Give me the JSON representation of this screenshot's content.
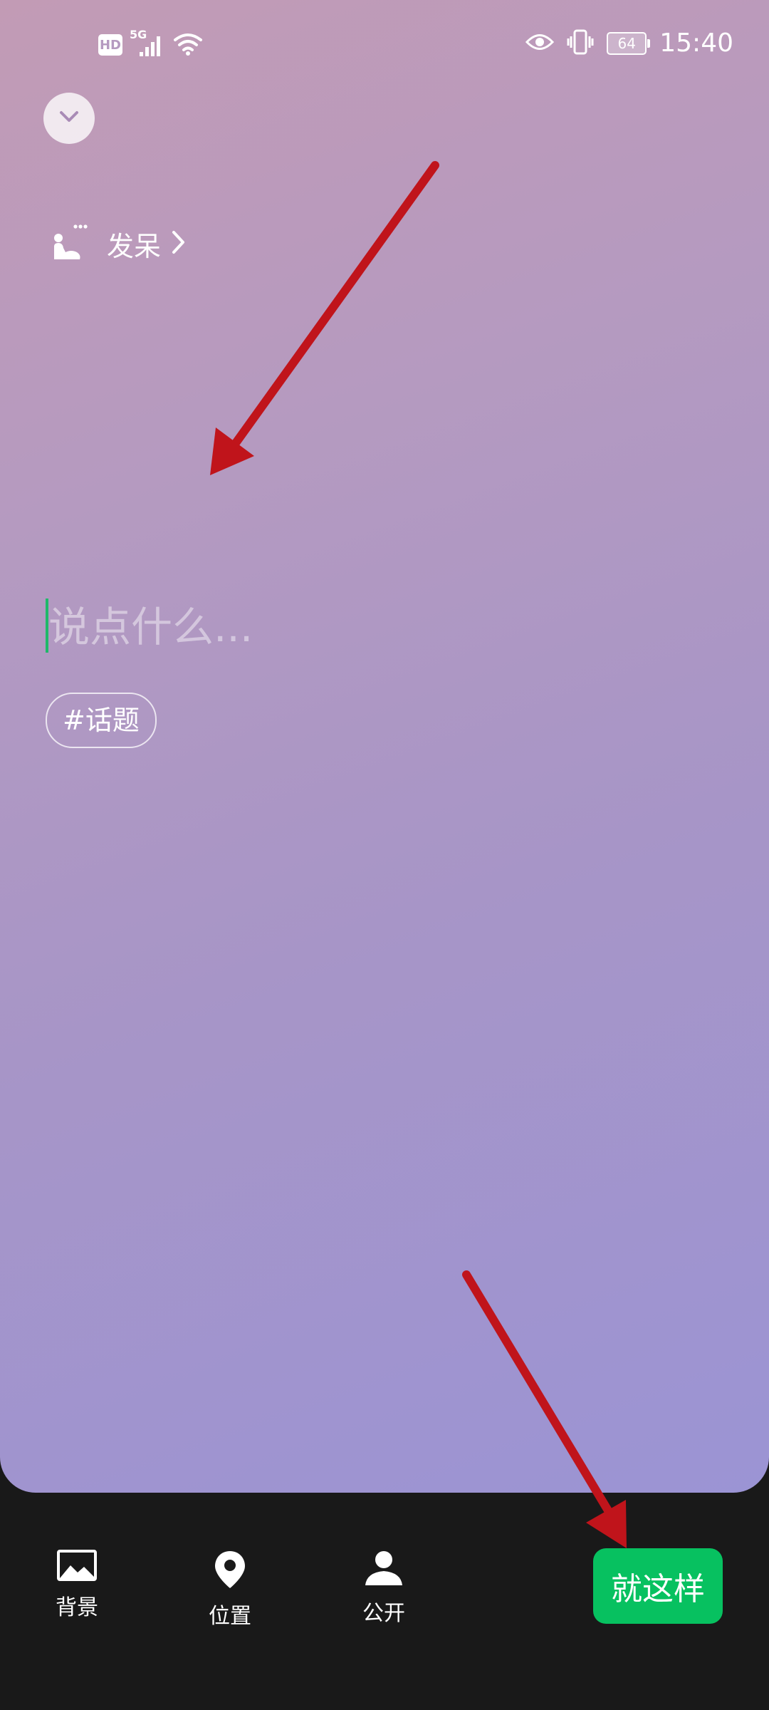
{
  "status_bar": {
    "hd": "HD",
    "network": "5G",
    "battery": "64",
    "time": "15:40"
  },
  "status": {
    "label": "发呆"
  },
  "composer": {
    "placeholder": "说点什么...",
    "topic": "#话题"
  },
  "toolbar": {
    "background_label": "背景",
    "location_label": "位置",
    "visibility_label": "公开",
    "submit_label": "就这样"
  },
  "colors": {
    "accent": "#07c160",
    "annotation_arrow": "#c0141b",
    "bottom_bar": "#191919"
  }
}
